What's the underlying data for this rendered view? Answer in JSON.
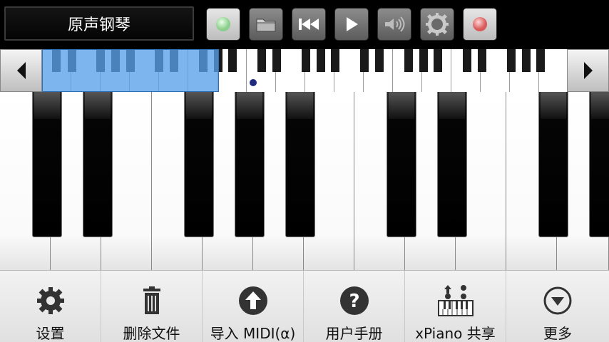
{
  "toolbar": {
    "instrument": "原声钢琴",
    "buttons": [
      {
        "id": "record",
        "icon": "green-circle-icon"
      },
      {
        "id": "open",
        "icon": "folder-icon"
      },
      {
        "id": "rewind",
        "icon": "rewind-icon"
      },
      {
        "id": "play",
        "icon": "play-icon"
      },
      {
        "id": "volume",
        "icon": "speaker-icon"
      },
      {
        "id": "metronome",
        "icon": "gear-ring-icon"
      },
      {
        "id": "stop",
        "icon": "red-circle-icon"
      }
    ]
  },
  "navigator": {
    "left_icon": "arrow-left-icon",
    "right_icon": "arrow-right-icon"
  },
  "menu": {
    "items": [
      {
        "label": "设置",
        "icon": "gear-icon"
      },
      {
        "label": "删除文件",
        "icon": "trash-icon"
      },
      {
        "label": "导入 MIDI(α)",
        "icon": "upload-arrow-icon"
      },
      {
        "label": "用户手册",
        "icon": "help-icon"
      },
      {
        "label": "xPiano 共享",
        "icon": "share-piano-icon"
      },
      {
        "label": "更多",
        "icon": "more-dropdown-icon"
      }
    ]
  }
}
